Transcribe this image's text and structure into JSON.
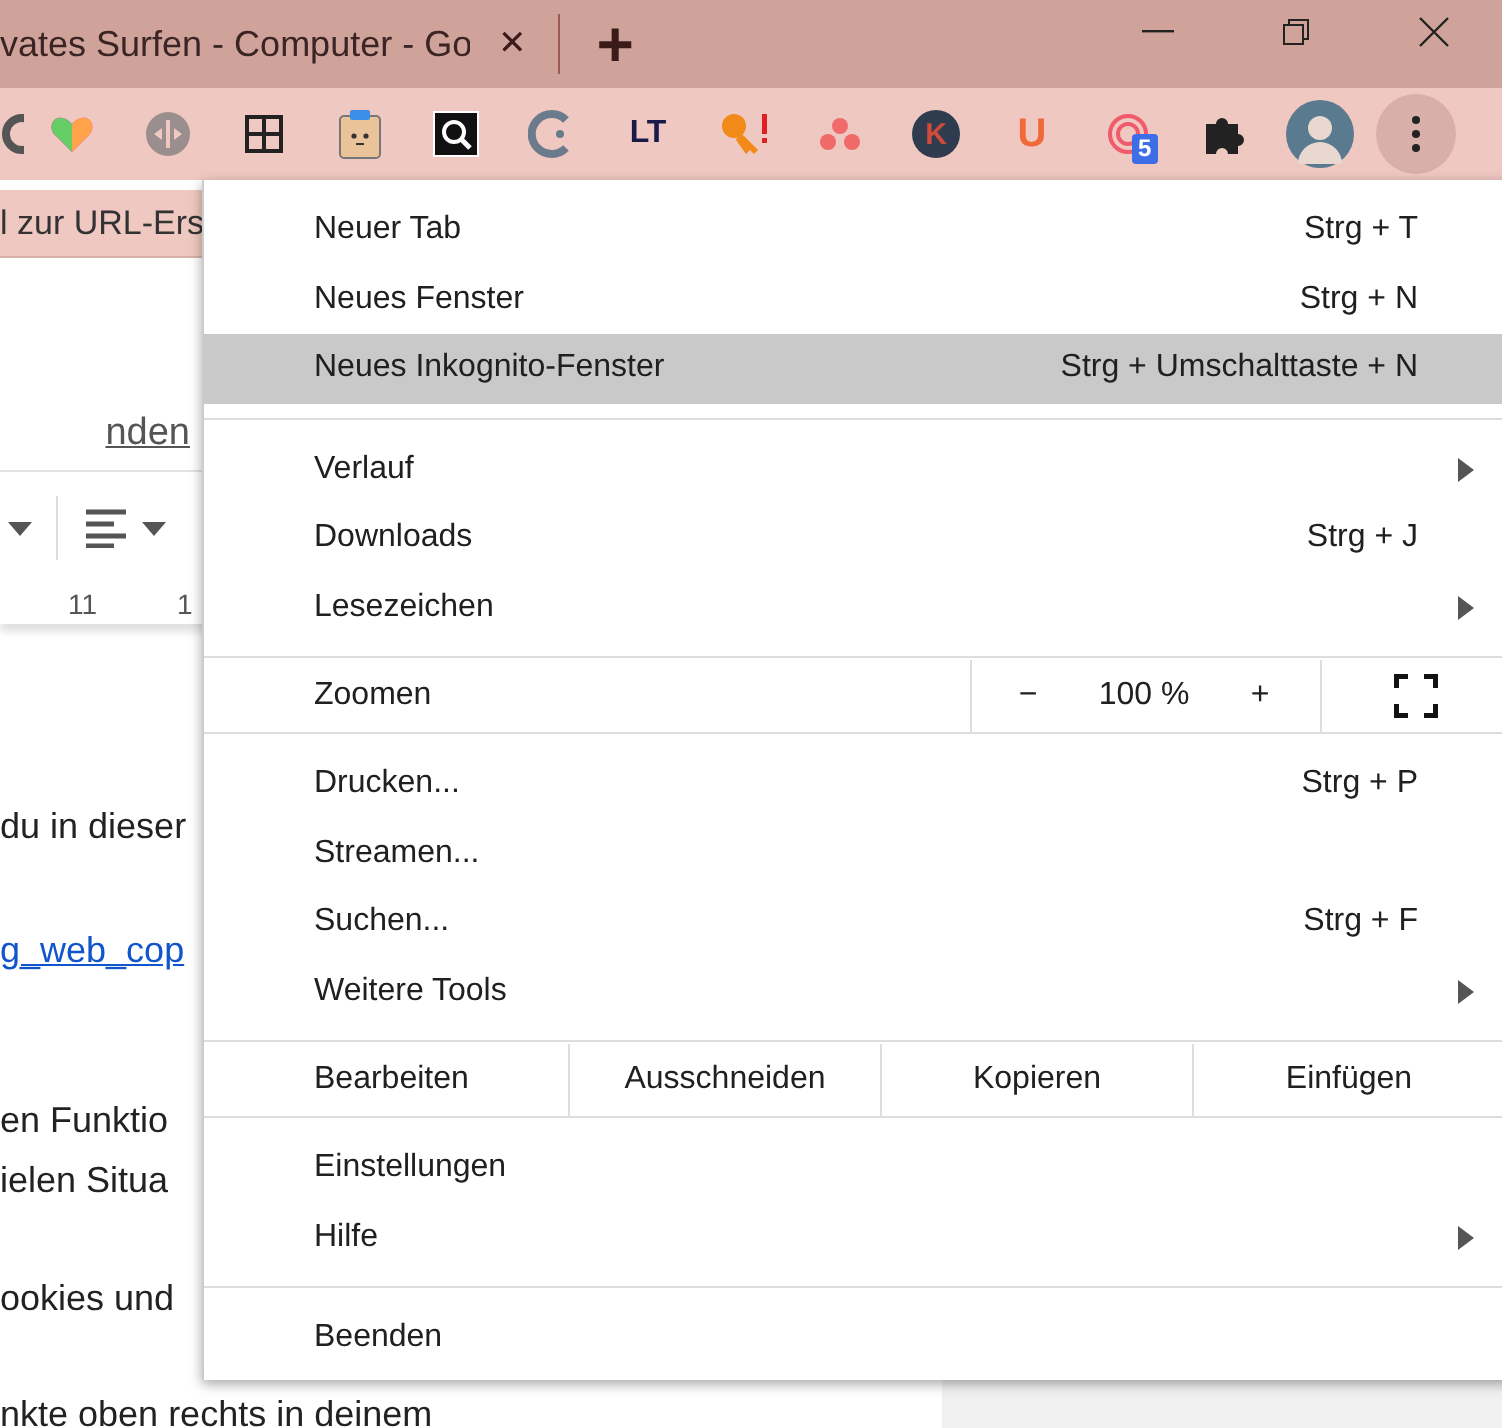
{
  "tab": {
    "title": "vates Surfen - Computer - Go",
    "close": "✕",
    "new_tab": "+"
  },
  "extensions": [
    {
      "kind": "ring"
    },
    {
      "kind": "heart"
    },
    {
      "kind": "pin"
    },
    {
      "kind": "grid"
    },
    {
      "kind": "clipboard"
    },
    {
      "kind": "lens"
    },
    {
      "kind": "crescent"
    },
    {
      "kind": "text-logo",
      "label": "LT"
    },
    {
      "kind": "key"
    },
    {
      "kind": "dots"
    },
    {
      "kind": "letter-circle",
      "label": "K"
    },
    {
      "kind": "letter",
      "label": "U"
    },
    {
      "kind": "spiral",
      "badge": "5"
    },
    {
      "kind": "puzzle"
    },
    {
      "kind": "avatar"
    }
  ],
  "bookmark_bar": {
    "text": "l zur URL-Ers"
  },
  "document": {
    "link": "nden",
    "ruler": [
      "11",
      "1"
    ],
    "paragraphs": [
      {
        "text": "du in dieser",
        "kind": "text"
      },
      {
        "text": "g_web_cop",
        "kind": "link"
      },
      {
        "text": "en Funktio",
        "kind": "text"
      },
      {
        "text": "ielen Situa",
        "kind": "text"
      },
      {
        "text": "ookies und",
        "kind": "text"
      },
      {
        "text": "nkte oben rechts in deinem",
        "kind": "text"
      }
    ]
  },
  "menu": {
    "sections": [
      {
        "kind": "items",
        "items": [
          {
            "label": "Neuer Tab",
            "shortcut": "Strg + T",
            "submenu": false,
            "highlighted": false
          },
          {
            "label": "Neues Fenster",
            "shortcut": "Strg + N",
            "submenu": false,
            "highlighted": false
          },
          {
            "label": "Neues Inkognito-Fenster",
            "shortcut": "Strg + Umschalttaste + N",
            "submenu": false,
            "highlighted": true
          }
        ]
      },
      {
        "kind": "items",
        "items": [
          {
            "label": "Verlauf",
            "submenu": true,
            "highlighted": false
          },
          {
            "label": "Downloads",
            "shortcut": "Strg + J",
            "submenu": false,
            "highlighted": false
          },
          {
            "label": "Lesezeichen",
            "submenu": true,
            "highlighted": false
          }
        ]
      },
      {
        "kind": "zoom",
        "label": "Zoomen",
        "minus": "−",
        "value": "100 %",
        "plus": "+"
      },
      {
        "kind": "items",
        "items": [
          {
            "label": "Drucken...",
            "shortcut": "Strg + P",
            "submenu": false,
            "highlighted": false
          },
          {
            "label": "Streamen...",
            "submenu": false,
            "highlighted": false
          },
          {
            "label": "Suchen...",
            "shortcut": "Strg + F",
            "submenu": false,
            "highlighted": false
          },
          {
            "label": "Weitere Tools",
            "submenu": true,
            "highlighted": false
          }
        ]
      },
      {
        "kind": "edit",
        "label": "Bearbeiten",
        "buttons": [
          "Ausschneiden",
          "Kopieren",
          "Einfügen"
        ]
      },
      {
        "kind": "items",
        "items": [
          {
            "label": "Einstellungen",
            "submenu": false,
            "highlighted": false
          },
          {
            "label": "Hilfe",
            "submenu": true,
            "highlighted": false
          }
        ]
      },
      {
        "kind": "items",
        "items": [
          {
            "label": "Beenden",
            "submenu": false,
            "highlighted": false
          }
        ]
      }
    ]
  }
}
